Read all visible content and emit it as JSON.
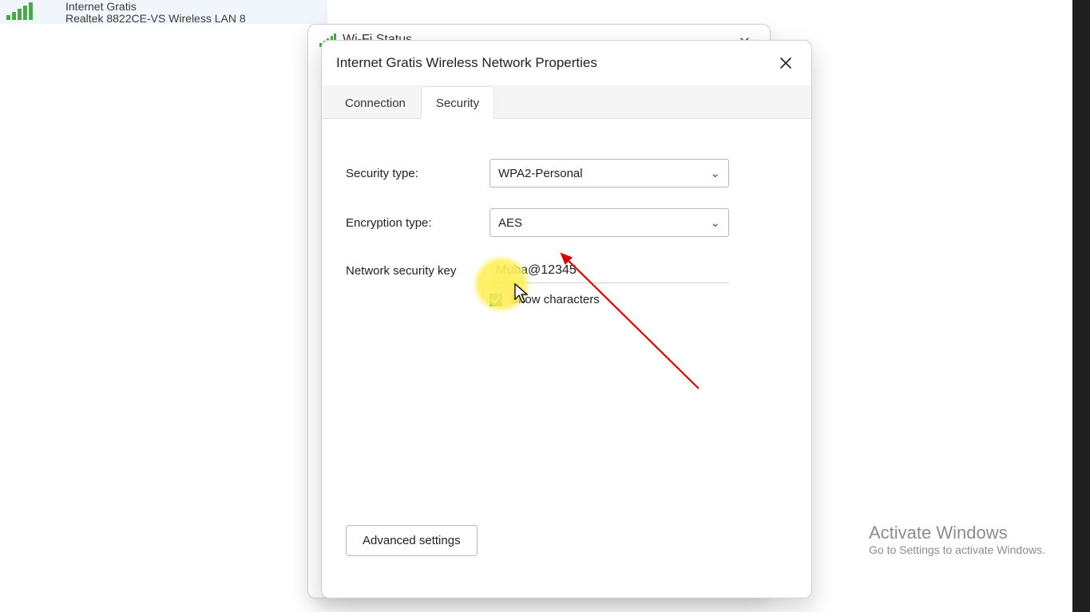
{
  "network_item": {
    "name": "Internet Gratis",
    "adapter": "Realtek 8822CE-VS Wireless LAN 8"
  },
  "wifi_status": {
    "title": "Wi-Fi Status"
  },
  "dialog": {
    "title": "Internet Gratis Wireless Network Properties",
    "tabs": {
      "connection": "Connection",
      "security": "Security"
    },
    "fields": {
      "security_type_label": "Security type:",
      "security_type_value": "WPA2-Personal",
      "encryption_type_label": "Encryption type:",
      "encryption_type_value": "AES",
      "network_security_key_label": "Network security key",
      "network_security_key_value": "Muba@12345",
      "show_characters_label": "Show characters"
    },
    "advanced_settings": "Advanced settings"
  },
  "watermark": {
    "line1": "Activate Windows",
    "line2": "Go to Settings to activate Windows."
  }
}
